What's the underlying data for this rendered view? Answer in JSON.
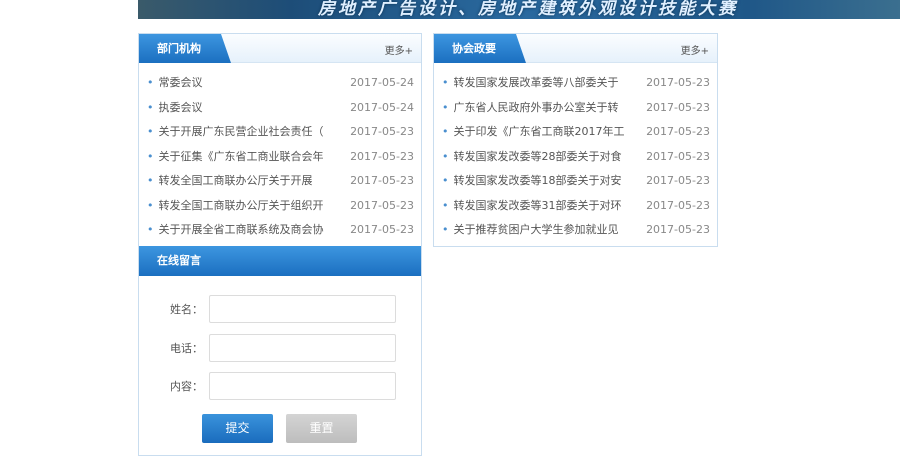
{
  "banner": {
    "title": "房地产广告设计、房地产建筑外观设计技能大赛"
  },
  "dept": {
    "title": "部门机构",
    "more": "更多+",
    "items": [
      {
        "t": "常委会议",
        "d": "2017-05-24"
      },
      {
        "t": "执委会议",
        "d": "2017-05-24"
      },
      {
        "t": "关于开展广东民营企业社会责任（",
        "d": "2017-05-23"
      },
      {
        "t": "关于征集《广东省工商业联合会年",
        "d": "2017-05-23"
      },
      {
        "t": "转发全国工商联办公厅关于开展",
        "d": "2017-05-23"
      },
      {
        "t": "转发全国工商联办公厅关于组织开",
        "d": "2017-05-23"
      },
      {
        "t": "关于开展全省工商联系统及商会协",
        "d": "2017-05-23"
      }
    ]
  },
  "policy": {
    "title": "协会政要",
    "more": "更多+",
    "items": [
      {
        "t": "转发国家发展改革委等八部委关于",
        "d": "2017-05-23"
      },
      {
        "t": "广东省人民政府外事办公室关于转",
        "d": "2017-05-23"
      },
      {
        "t": "关于印发《广东省工商联2017年工",
        "d": "2017-05-23"
      },
      {
        "t": "转发国家发改委等28部委关于对食",
        "d": "2017-05-23"
      },
      {
        "t": "转发国家发改委等18部委关于对安",
        "d": "2017-05-23"
      },
      {
        "t": "转发国家发改委等31部委关于对环",
        "d": "2017-05-23"
      },
      {
        "t": "关于推荐贫困户大学生参加就业见",
        "d": "2017-05-23"
      }
    ]
  },
  "message": {
    "title": "在线留言",
    "name_label": "姓名：",
    "phone_label": "电话：",
    "content_label": "内容：",
    "submit": "提交",
    "reset": "重置"
  }
}
